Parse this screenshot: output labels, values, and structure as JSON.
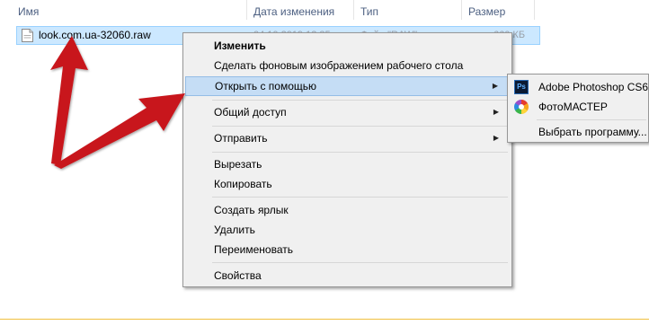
{
  "columns": {
    "name": "Имя",
    "date": "Дата изменения",
    "type": "Тип",
    "size": "Размер"
  },
  "file": {
    "name": "look.com.ua-32060.raw",
    "date_partial": "04.10.2019 12:35",
    "type_partial": "Файл \"RAW\"",
    "size_partial": "660 КБ"
  },
  "context_menu": {
    "items": [
      {
        "label": "Изменить",
        "bold": true
      },
      {
        "label": "Сделать фоновым изображением рабочего стола"
      },
      {
        "label": "Открыть с помощью",
        "submenu": true,
        "highlighted": true
      },
      {
        "label": "Общий доступ",
        "submenu": true
      },
      {
        "label": "Отправить",
        "submenu": true
      },
      {
        "label": "Вырезать"
      },
      {
        "label": "Копировать"
      },
      {
        "label": "Создать ярлык"
      },
      {
        "label": "Удалить"
      },
      {
        "label": "Переименовать"
      },
      {
        "label": "Свойства"
      }
    ]
  },
  "open_with_submenu": {
    "items": [
      {
        "label": "Adobe Photoshop CS6",
        "icon": "photoshop-icon",
        "icon_text": "Ps"
      },
      {
        "label": "ФотоМАСТЕР",
        "icon": "fotomaster-icon"
      },
      {
        "label": "Выбрать программу..."
      }
    ]
  },
  "colors": {
    "selection": "#cce8ff",
    "menu_bg": "#f0f0f0",
    "menu_highlight": "#c5ddf5",
    "arrow_red": "#c8131a"
  }
}
